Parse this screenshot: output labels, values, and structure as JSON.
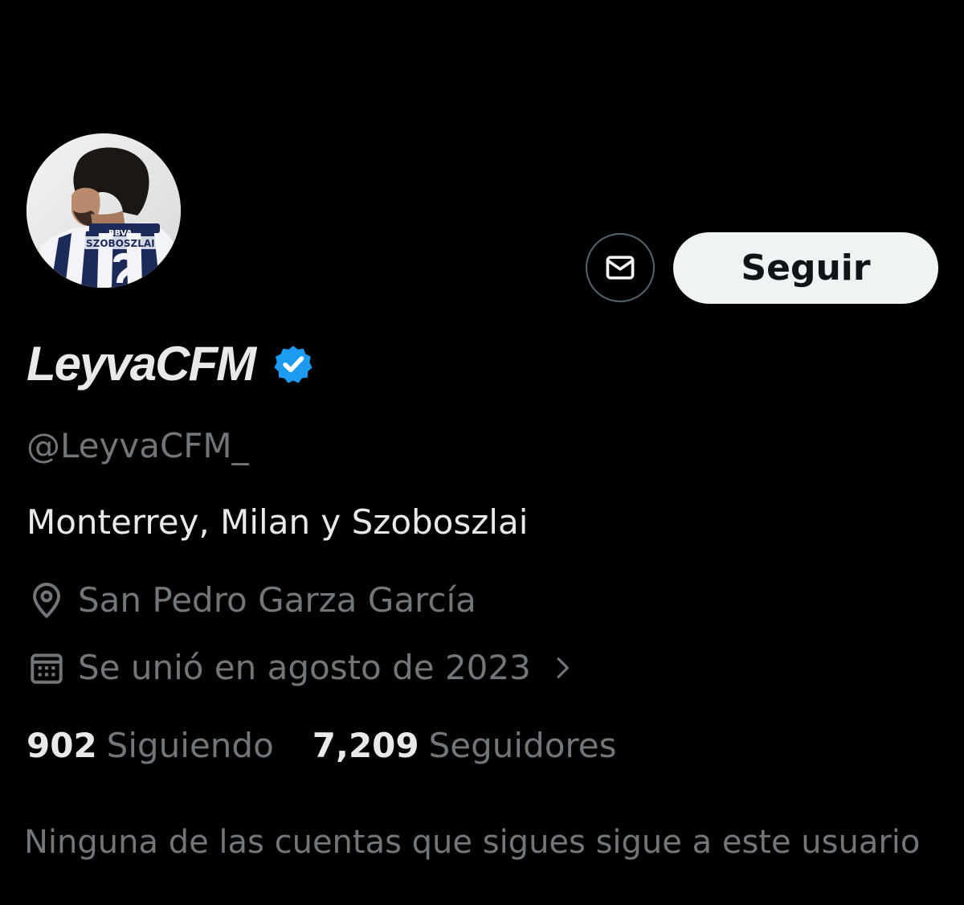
{
  "profile": {
    "display_name": "LeyvaCFM",
    "handle": "@LeyvaCFM_",
    "bio": "Monterrey, Milan y Szoboszlai",
    "location": "San Pedro Garza García",
    "joined": "Se unió en agosto de 2023",
    "verified": true,
    "avatar_jersey_text": [
      "BBVA",
      "SZOBOSZLAI"
    ]
  },
  "actions": {
    "follow_label": "Seguir",
    "message_icon": "mail-icon"
  },
  "stats": {
    "following_count": "902",
    "following_label": "Siguiendo",
    "followers_count": "7,209",
    "followers_label": "Seguidores"
  },
  "followed_by_text": "Ninguna de las cuentas que sigues sigue a este usuario",
  "colors": {
    "background": "#000000",
    "primary_text": "#e7e9ea",
    "secondary_text": "#71767b",
    "verified_blue": "#1d9bf0",
    "follow_button_bg": "#eff3f4",
    "follow_button_text": "#0f1419",
    "outline_border": "#536471"
  },
  "icons": {
    "verified": "verified-badge-icon",
    "location": "location-pin-icon",
    "calendar": "calendar-icon",
    "chevron": "chevron-right-icon"
  }
}
